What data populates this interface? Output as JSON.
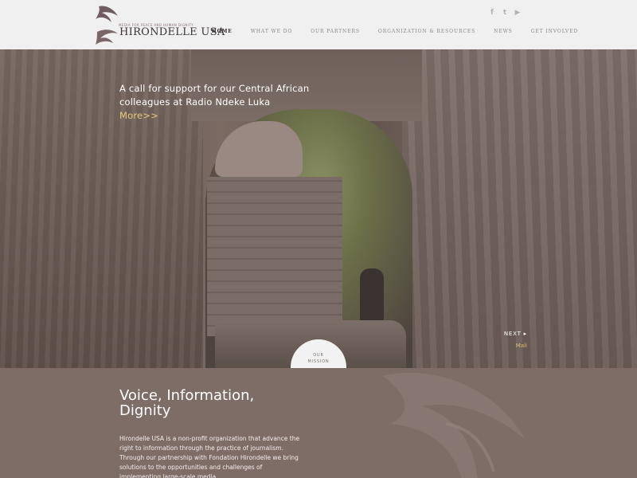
{
  "header": {
    "logo": {
      "tagline": "MEDIA FOR PEACE AND HUMAN DIGNITY",
      "name": "HIRONDELLE USA"
    },
    "social": [
      {
        "icon": "facebook-icon",
        "glyph": "f"
      },
      {
        "icon": "twitter-icon",
        "glyph": "t"
      },
      {
        "icon": "youtube-icon",
        "glyph": "▶"
      }
    ],
    "nav": [
      {
        "label": "HOME",
        "active": true
      },
      {
        "label": "WHAT WE DO",
        "active": false
      },
      {
        "label": "OUR PARTNERS",
        "active": false
      },
      {
        "label": "ORGANIZATION & RESOURCES",
        "active": false
      },
      {
        "label": "NEWS",
        "active": false
      },
      {
        "label": "GET INVOLVED",
        "active": false
      }
    ]
  },
  "hero": {
    "caption": "A call for support for our Central African colleagues at Radio Ndeke Luka",
    "more_label": "More>>",
    "next_label": "NEXT ▸",
    "next_sub": "Mali",
    "mission_tab_line1": "OUR",
    "mission_tab_line2": "MISSION",
    "mission_tab_arrow": "▾"
  },
  "mission": {
    "heading": "Voice, Information, Dignity",
    "body": "Hirondelle USA is a non-profit organization that advance the right to information through the practice of journalism. Through our partnership with Fondation Hirondelle we bring solutions to the opportunities and challenges of implementing large-scale media"
  },
  "colors": {
    "header_bg": "#f1f0f0",
    "mission_bg": "#7e6c67",
    "accent_more": "#e7c978",
    "nav_active": "#2a2527"
  }
}
